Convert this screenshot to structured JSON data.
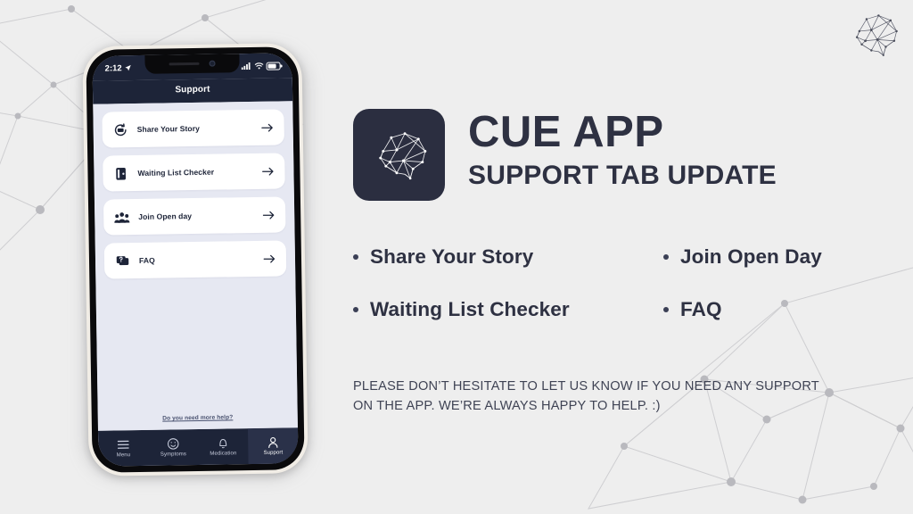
{
  "theme": {
    "canvas_bg": "#eeeeee",
    "brand_dark": "#2e3142",
    "phone_navy": "#1d2438",
    "phone_screen_bg": "#e6e8f2",
    "card_white": "#ffffff",
    "network_line": "#c9c9cc"
  },
  "corner_logo": {
    "icon": "brain-wireframe-icon"
  },
  "phone": {
    "status_bar": {
      "time": "2:12",
      "location_icon": "location-arrow-icon",
      "cellular_icon": "cellular-bars-icon",
      "wifi_icon": "wifi-icon",
      "battery_icon": "battery-icon"
    },
    "header_title": "Support",
    "cards": [
      {
        "label": "Share Your Story",
        "icon": "share-story-icon",
        "arrow": "arrow-right-icon"
      },
      {
        "label": "Waiting List Checker",
        "icon": "clipboard-icon",
        "arrow": "arrow-right-icon"
      },
      {
        "label": "Join Open day",
        "icon": "people-group-icon",
        "arrow": "arrow-right-icon"
      },
      {
        "label": "FAQ",
        "icon": "faq-chat-icon",
        "arrow": "arrow-right-icon"
      }
    ],
    "help_link": "Do you need more help?",
    "tabs": [
      {
        "label": "Menu",
        "icon": "hamburger-menu-icon",
        "active": false
      },
      {
        "label": "Symptoms",
        "icon": "smiley-face-icon",
        "active": false
      },
      {
        "label": "Medication",
        "icon": "bell-icon",
        "active": false
      },
      {
        "label": "Support",
        "icon": "person-icon",
        "active": true
      }
    ]
  },
  "slide": {
    "logo": {
      "icon": "brain-wireframe-icon"
    },
    "title": "CUE APP",
    "subtitle": "SUPPORT TAB UPDATE",
    "bullets": [
      "Share Your Story",
      "Join Open Day",
      "Waiting List Checker",
      "FAQ"
    ],
    "footnote": "PLEASE DON’T HESITATE TO LET US KNOW IF YOU NEED ANY SUPPORT ON THE APP. WE’RE ALWAYS HAPPY TO HELP. :)"
  }
}
